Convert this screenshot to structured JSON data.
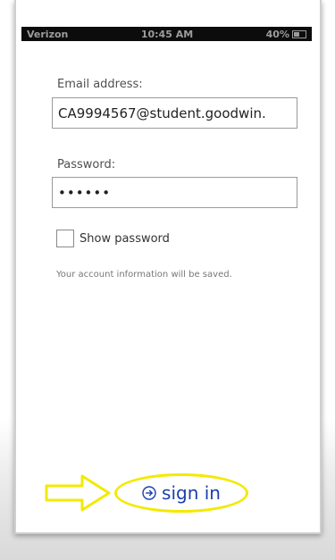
{
  "status_bar": {
    "carrier": "Verizon",
    "time": "10:45 AM",
    "battery": "40%"
  },
  "form": {
    "email_label": "Email address:",
    "email_value": "CA9994567@student.goodwin.",
    "password_label": "Password:",
    "password_value": "••••••",
    "show_password_label": "Show password",
    "account_note": "Your account information will be saved."
  },
  "signin": {
    "label": "sign in",
    "icon": "arrow-circle-icon"
  },
  "colors": {
    "link_blue": "#1a3fae",
    "highlight_yellow": "#f2ea00"
  }
}
